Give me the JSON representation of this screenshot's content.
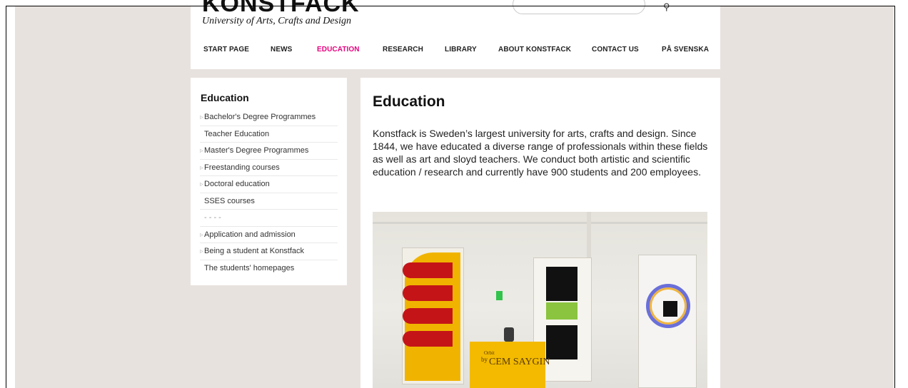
{
  "site": {
    "logo_text": "KONSTFACK",
    "tagline": "University of Arts, Crafts and Design"
  },
  "search": {
    "placeholder": ""
  },
  "nav": {
    "items": [
      {
        "label": "START PAGE",
        "active": false
      },
      {
        "label": "NEWS",
        "active": false
      },
      {
        "label": "EDUCATION",
        "active": true
      },
      {
        "label": "RESEARCH",
        "active": false
      },
      {
        "label": "LIBRARY",
        "active": false
      },
      {
        "label": "ABOUT KONSTFACK",
        "active": false
      },
      {
        "label": "CONTACT US",
        "active": false
      },
      {
        "label": "PÅ SVENSKA",
        "active": false
      }
    ],
    "active_color": "#e6007e"
  },
  "sidebar": {
    "title": "Education",
    "items": [
      {
        "label": "Bachelor's Degree Programmes",
        "has_arrow": true
      },
      {
        "label": "Teacher Education",
        "has_arrow": false
      },
      {
        "label": "Master's Degree Programmes",
        "has_arrow": true
      },
      {
        "label": "Freestanding courses",
        "has_arrow": true
      },
      {
        "label": "Doctoral education",
        "has_arrow": true
      },
      {
        "label": "SSES courses",
        "has_arrow": false
      },
      {
        "label": "- - - -",
        "has_arrow": false
      },
      {
        "label": "Application and admission",
        "has_arrow": true
      },
      {
        "label": "Being a student at Konstfack",
        "has_arrow": true
      },
      {
        "label": "The students' homepages",
        "has_arrow": false
      }
    ]
  },
  "main": {
    "title": "Education",
    "intro": "Konstfack is Sweden’s largest university for arts, crafts and design. Since 1844, we have educated a diverse range of professionals within these fields as well as art and sloyd teachers. We conduct both artistic and scientific education / research and currently have 900 students and 200 employees.",
    "photo": {
      "pedestal_small": "Orbit",
      "pedestal_by": "by",
      "pedestal_name": "CEM SAYGIN"
    }
  }
}
